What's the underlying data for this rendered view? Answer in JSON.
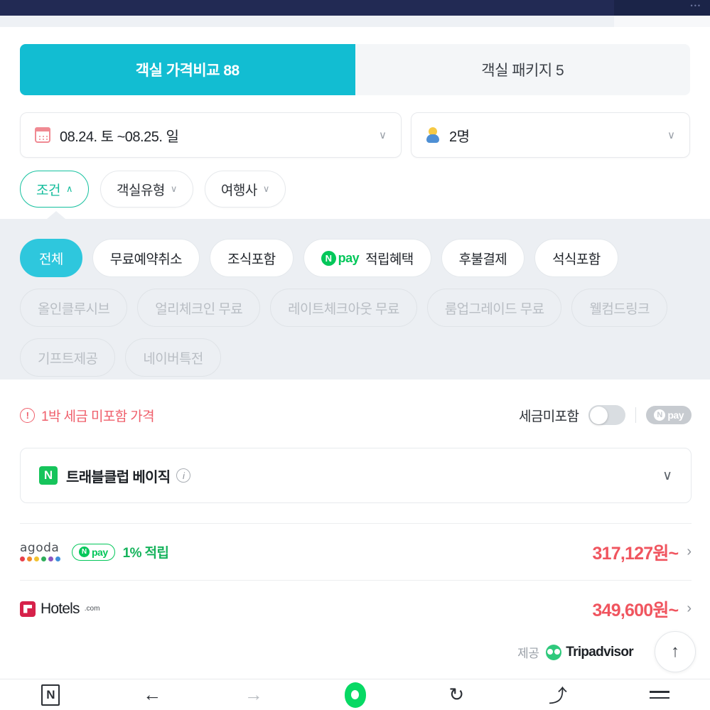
{
  "topbar": {
    "dots": "•••"
  },
  "tabs": [
    {
      "label": "객실 가격비교 88",
      "active": true,
      "name": "tab-room-price-compare"
    },
    {
      "label": "객실 패키지 5",
      "active": false,
      "name": "tab-room-package"
    }
  ],
  "selectors": {
    "date": {
      "value": "08.24. 토 ~08.25. 일",
      "icon": "calendar-icon",
      "caret": "∨"
    },
    "guest": {
      "value": "2명",
      "icon": "person-icon",
      "caret": "∨"
    }
  },
  "filter_buttons": [
    {
      "label": "조건",
      "arrow": "∧",
      "selected": true,
      "name": "filter-button-conditions"
    },
    {
      "label": "객실유형",
      "arrow": "∨",
      "selected": false,
      "name": "filter-button-room-type"
    },
    {
      "label": "여행사",
      "arrow": "∨",
      "selected": false,
      "name": "filter-button-agency"
    }
  ],
  "condition_chips": [
    {
      "label": "전체",
      "state": "active"
    },
    {
      "label": "무료예약취소",
      "state": "normal"
    },
    {
      "label": "조식포함",
      "state": "normal"
    },
    {
      "label": "적립혜택",
      "state": "normal",
      "npay": true
    },
    {
      "label": "후불결제",
      "state": "normal"
    },
    {
      "label": "석식포함",
      "state": "normal"
    },
    {
      "label": "올인클루시브",
      "state": "disabled"
    },
    {
      "label": "얼리체크인 무료",
      "state": "disabled"
    },
    {
      "label": "레이트체크아웃 무료",
      "state": "disabled"
    },
    {
      "label": "룸업그레이드 무료",
      "state": "disabled"
    },
    {
      "label": "웰컴드링크",
      "state": "disabled"
    },
    {
      "label": "기프트제공",
      "state": "disabled"
    },
    {
      "label": "네이버특전",
      "state": "disabled"
    }
  ],
  "tax_row": {
    "warning": "1박 세금 미포함 가격",
    "warning_icon": "!",
    "toggle_label": "세금미포함",
    "toggle_on": false,
    "npay_pill": {
      "n": "N",
      "pay": "pay"
    }
  },
  "travel_club": {
    "badge": "N",
    "title": "트래블클럽 베이직",
    "info_icon": "i",
    "caret": "∨"
  },
  "price_rows": [
    {
      "provider": "agoda",
      "provider_word": "agoda",
      "npay_badge": {
        "n": "N",
        "pay": "pay"
      },
      "benefit": "1% 적립",
      "price": "317,127원~",
      "chevron": "›"
    },
    {
      "provider": "hotels",
      "provider_word": "Hotels",
      "provider_tld": ".com",
      "price": "349,600원~",
      "chevron": "›"
    }
  ],
  "attribution": {
    "by": "제공",
    "source": "Tripadvisor"
  },
  "scroll_top": {
    "arrow": "↑"
  },
  "bottom_nav": [
    {
      "name": "naver-logo-button",
      "glyph": "N"
    },
    {
      "name": "back-button",
      "glyph": "←"
    },
    {
      "name": "forward-button",
      "glyph": "→"
    },
    {
      "name": "home-button",
      "glyph": ""
    },
    {
      "name": "refresh-button",
      "glyph": "↻"
    },
    {
      "name": "share-button",
      "glyph": "⤴"
    },
    {
      "name": "menu-button",
      "glyph": ""
    }
  ],
  "colors": {
    "tab_active": "#12bdd2",
    "chip_active": "#2ec7dd",
    "accent_green": "#16c2a0",
    "npay_green": "#03c75a",
    "price_red": "#f0555f",
    "warning_red": "#ef5f6b",
    "panel_bg": "#eceff3"
  },
  "agoda_dot_colors": [
    "#e8404a",
    "#f08a2a",
    "#f2c230",
    "#2fae5a",
    "#8b56c0",
    "#3f8fdb"
  ]
}
